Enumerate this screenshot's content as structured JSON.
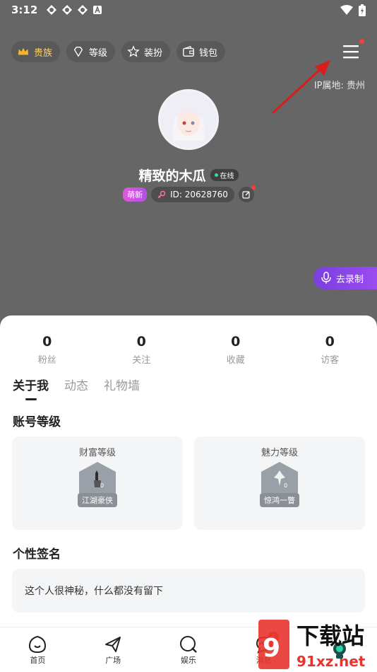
{
  "status_bar": {
    "time": "3:12"
  },
  "top_chips": [
    {
      "label": "贵族",
      "icon": "crown-icon"
    },
    {
      "label": "等级",
      "icon": "diamond-icon"
    },
    {
      "label": "装扮",
      "icon": "star-icon"
    },
    {
      "label": "钱包",
      "icon": "wallet-icon"
    }
  ],
  "ip_location": "IP属地: 贵州",
  "profile": {
    "username": "精致的木瓜",
    "online_status": "在线",
    "newbie_tag": "萌新",
    "user_id": "ID: 20628760"
  },
  "record_button": "去录制",
  "stats": [
    {
      "value": "0",
      "label": "粉丝"
    },
    {
      "value": "0",
      "label": "关注"
    },
    {
      "value": "0",
      "label": "收藏"
    },
    {
      "value": "0",
      "label": "访客"
    }
  ],
  "tabs": [
    "关于我",
    "动态",
    "礼物墙"
  ],
  "account_level": {
    "title": "账号等级",
    "wealth": {
      "title": "财富等级",
      "badge": "江湖豪侠",
      "level": "0"
    },
    "charm": {
      "title": "魅力等级",
      "badge": "惊鸿一瞥",
      "level": "0"
    }
  },
  "signature": {
    "title": "个性签名",
    "text": "这个人很神秘，什么都没有留下"
  },
  "bottom_nav": [
    {
      "label": "首页",
      "icon": "home-icon"
    },
    {
      "label": "广场",
      "icon": "plane-icon"
    },
    {
      "label": "娱乐",
      "icon": "entertainment-icon"
    },
    {
      "label": "消息",
      "icon": "message-icon",
      "badge": "4"
    },
    {
      "label": "",
      "icon": "mine-icon"
    }
  ],
  "watermark": {
    "brand": "下载站",
    "url": "91xz.net"
  }
}
